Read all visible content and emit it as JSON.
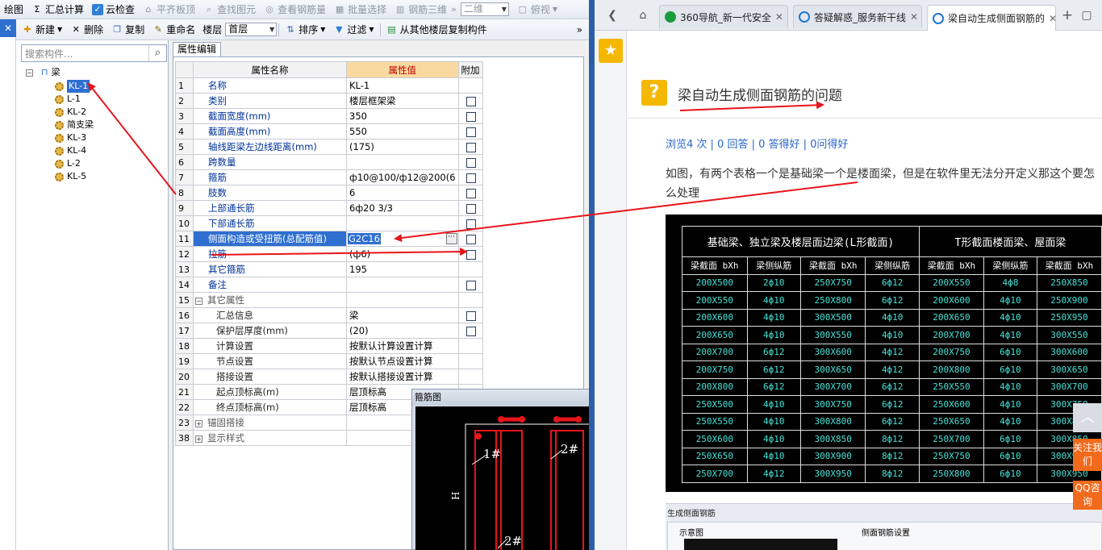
{
  "toolbar1": {
    "draw": "绘图",
    "sum": "汇总计算",
    "cloud_check": "云检查",
    "level_slab": "平齐板顶",
    "find_element": "查找图元",
    "view_rebar": "查看钢筋量",
    "batch_select": "批量选择",
    "rebar_3d": "钢筋三维",
    "view_2d": "二维",
    "view_top": "俯视"
  },
  "toolbar2": {
    "new": "新建",
    "delete": "删除",
    "copy": "复制",
    "rename": "重命名",
    "floor_label": "楼层",
    "floor_value": "首层",
    "sort": "排序",
    "filter": "过滤",
    "copy_from_floor": "从其他楼层复制构件"
  },
  "left_strip": {
    "close": "✕"
  },
  "tree": {
    "search_placeholder": "搜索构件...",
    "root": "梁",
    "items": [
      "KL-1",
      "L-1",
      "KL-2",
      "简支梁",
      "KL-3",
      "KL-4",
      "L-2",
      "KL-5"
    ],
    "selected": "KL-1"
  },
  "property_panel": {
    "tab": "属性编辑",
    "headers": {
      "num": "",
      "name": "属性名称",
      "value": "属性值",
      "extra": "附加"
    },
    "rows": [
      {
        "n": "1",
        "name": "名称",
        "value": "KL-1",
        "cb": false
      },
      {
        "n": "2",
        "name": "类别",
        "value": "楼层框架梁",
        "cb": true
      },
      {
        "n": "3",
        "name": "截面宽度(mm)",
        "value": "350",
        "cb": true
      },
      {
        "n": "4",
        "name": "截面高度(mm)",
        "value": "550",
        "cb": true
      },
      {
        "n": "5",
        "name": "轴线距梁左边线距离(mm)",
        "value": "(175)",
        "cb": true
      },
      {
        "n": "6",
        "name": "跨数量",
        "value": "",
        "cb": true
      },
      {
        "n": "7",
        "name": "箍筋",
        "value": "ф10@100/ф12@200(6",
        "cb": true
      },
      {
        "n": "8",
        "name": "肢数",
        "value": "6",
        "cb": true
      },
      {
        "n": "9",
        "name": "上部通长筋",
        "value": "6ф20 3/3",
        "cb": true
      },
      {
        "n": "10",
        "name": "下部通长筋",
        "value": "",
        "cb": true
      },
      {
        "n": "11",
        "name": "侧面构造或受扭筋(总配筋值)",
        "value": "G2C16",
        "cb": true
      },
      {
        "n": "12",
        "name": "拉筋",
        "value": "(ф6)",
        "cb": true
      },
      {
        "n": "13",
        "name": "其它箍筋",
        "value": "195",
        "cb": false
      },
      {
        "n": "14",
        "name": "备注",
        "value": "",
        "cb": true
      },
      {
        "n": "15",
        "name": "其它属性",
        "value": "",
        "cb": false
      },
      {
        "n": "16",
        "name": "汇总信息",
        "value": "梁",
        "cb": true
      },
      {
        "n": "17",
        "name": "保护层厚度(mm)",
        "value": "(20)",
        "cb": true
      },
      {
        "n": "18",
        "name": "计算设置",
        "value": "按默认计算设置计算",
        "cb": false
      },
      {
        "n": "19",
        "name": "节点设置",
        "value": "按默认节点设置计算",
        "cb": false
      },
      {
        "n": "20",
        "name": "搭接设置",
        "value": "按默认搭接设置计算",
        "cb": false
      },
      {
        "n": "21",
        "name": "起点顶标高(m)",
        "value": "层顶标高",
        "cb": false
      },
      {
        "n": "22",
        "name": "终点顶标高(m)",
        "value": "层顶标高",
        "cb": false
      },
      {
        "n": "23",
        "name": "锚固搭接",
        "value": "",
        "cb": false
      },
      {
        "n": "38",
        "name": "显示样式",
        "value": "",
        "cb": false
      }
    ]
  },
  "stirrup_window": {
    "title": "箍筋图",
    "labels": [
      "1#",
      "2#",
      "2#",
      "H"
    ]
  },
  "browser": {
    "tabs": [
      {
        "title": "360导航_新一代安全",
        "icon_color": "#1a9d3c"
      },
      {
        "title": "答疑解惑_服务新干线",
        "icon_color": "#1e78d2"
      },
      {
        "title": "梁自动生成侧面钢筋的",
        "icon_color": "#1e78d2"
      }
    ],
    "new_tab": "+",
    "page": {
      "question_title": "梁自动生成侧面钢筋的问题",
      "stats": "浏览4 次 | 0 回答 | 0 答得好 | 0问得好",
      "body": "如图，有两个表格一个是基础梁一个是楼面梁，但是在软件里无法分开定义那这个要怎么处理",
      "cad_table": {
        "group_titles": [
          "基础梁、独立梁及楼层面边梁(L形截面)",
          "T形截面楼面梁、屋面梁"
        ],
        "col_headers": [
          "梁截面 bXh",
          "梁侧纵筋",
          "梁截面 bXh",
          "梁侧纵筋",
          "梁截面 bXh",
          "梁侧纵筋",
          "梁截面 bXh"
        ],
        "rows": [
          [
            "200X500",
            "2ф10",
            "250X750",
            "6ф12",
            "200X550",
            "4ф8",
            "250X850"
          ],
          [
            "200X550",
            "4ф10",
            "250X800",
            "6ф12",
            "200X600",
            "4ф10",
            "250X900"
          ],
          [
            "200X600",
            "4ф10",
            "300X500",
            "4ф10",
            "200X650",
            "4ф10",
            "250X950"
          ],
          [
            "200X650",
            "4ф10",
            "300X550",
            "4ф10",
            "200X700",
            "4ф10",
            "300X550"
          ],
          [
            "200X700",
            "6ф12",
            "300X600",
            "4ф12",
            "200X750",
            "6ф10",
            "300X600"
          ],
          [
            "200X750",
            "6ф12",
            "300X650",
            "4ф12",
            "200X800",
            "6ф10",
            "300X650"
          ],
          [
            "200X800",
            "6ф12",
            "300X700",
            "6ф12",
            "250X550",
            "4ф10",
            "300X700"
          ],
          [
            "250X500",
            "4ф10",
            "300X750",
            "6ф12",
            "250X600",
            "4ф10",
            "300X750"
          ],
          [
            "250X550",
            "4ф10",
            "300X800",
            "6ф12",
            "250X650",
            "4ф10",
            "300X800"
          ],
          [
            "250X600",
            "4ф10",
            "300X850",
            "8ф12",
            "250X700",
            "6ф10",
            "300X850"
          ],
          [
            "250X650",
            "4ф10",
            "300X900",
            "8ф12",
            "250X750",
            "6ф10",
            "300X900"
          ],
          [
            "250X700",
            "4ф12",
            "300X950",
            "8ф12",
            "250X800",
            "6ф10",
            "300X950"
          ]
        ]
      },
      "second_image": {
        "title": "生成侧面钢筋",
        "left_label": "示意图",
        "right_label": "侧面钢筋设置"
      }
    },
    "side_buttons": {
      "follow": "关注我们",
      "qq": "QQ咨询"
    }
  },
  "colors": {
    "accent_blue": "#2f6fd0",
    "value_header": "#f9d9a0",
    "arrow_red": "#e8141b",
    "cad_cyan": "#46e2d8",
    "question_yellow": "#f5b800",
    "side_orange": "#f26a1b"
  }
}
